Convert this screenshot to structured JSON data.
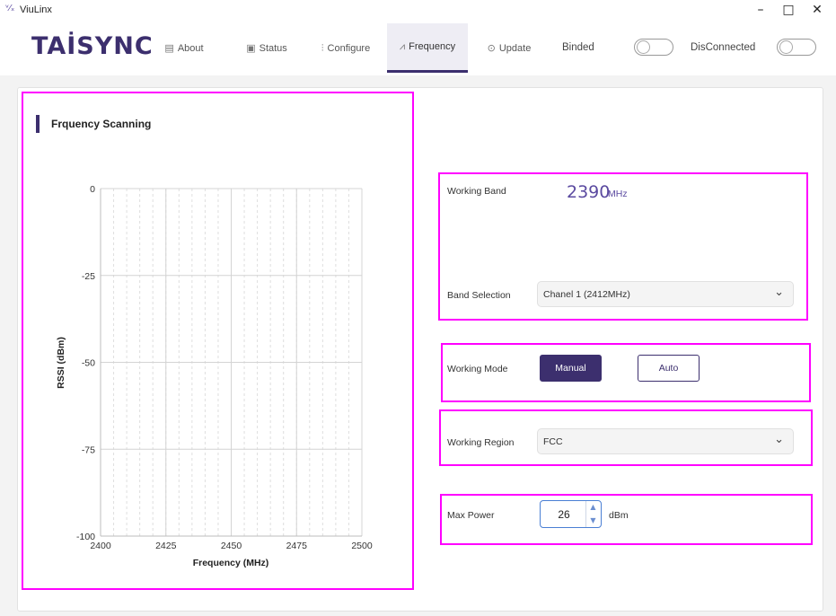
{
  "window": {
    "app_name": "ViuLinx",
    "app_icon": "viulinx-logo-icon",
    "minimize": "–",
    "maximize": "□",
    "close": "✕"
  },
  "header": {
    "logo": "TAİSYNC",
    "nav": [
      {
        "label": "About",
        "icon": "monitor-icon",
        "glyph": "▤"
      },
      {
        "label": "Status",
        "icon": "status-icon",
        "glyph": "▣"
      },
      {
        "label": "Configure",
        "icon": "sliders-icon",
        "glyph": "⫶"
      },
      {
        "label": "Frequency",
        "icon": "line-chart-icon",
        "glyph": "⩘"
      },
      {
        "label": "Update",
        "icon": "upload-circle-icon",
        "glyph": "⊙"
      }
    ],
    "active_tab": "Frequency",
    "binded_label": "Binded",
    "binded_on": false,
    "connection_label": "DisConnected",
    "connection_on": false
  },
  "scan": {
    "title": "Frquency Scanning"
  },
  "chart_data": {
    "type": "line",
    "title": "",
    "xlabel": "Frequency (MHz)",
    "ylabel": "RSSI (dBm)",
    "xlim": [
      2400,
      2500
    ],
    "ylim": [
      -100,
      0
    ],
    "x_ticks": [
      "2400",
      "2425",
      "2450",
      "2475",
      "2500"
    ],
    "y_ticks": [
      "0",
      "-25",
      "-50",
      "-75",
      "-100"
    ],
    "grid": true,
    "series": []
  },
  "settings": {
    "working_band_label": "Working Band",
    "working_band_value": "2390",
    "working_band_unit": "MHz",
    "band_selection_label": "Band Selection",
    "band_selection_value": "Chanel 1 (2412MHz)",
    "working_mode_label": "Working Mode",
    "mode_manual": "Manual",
    "mode_auto": "Auto",
    "selected_mode": "Manual",
    "working_region_label": "Working Region",
    "working_region_value": "FCC",
    "max_power_label": "Max Power",
    "max_power_value": "26",
    "max_power_unit": "dBm"
  },
  "colors": {
    "accent": "#3c2f6e",
    "highlight": "#ff00ff",
    "band_value": "#5b4aa0"
  }
}
